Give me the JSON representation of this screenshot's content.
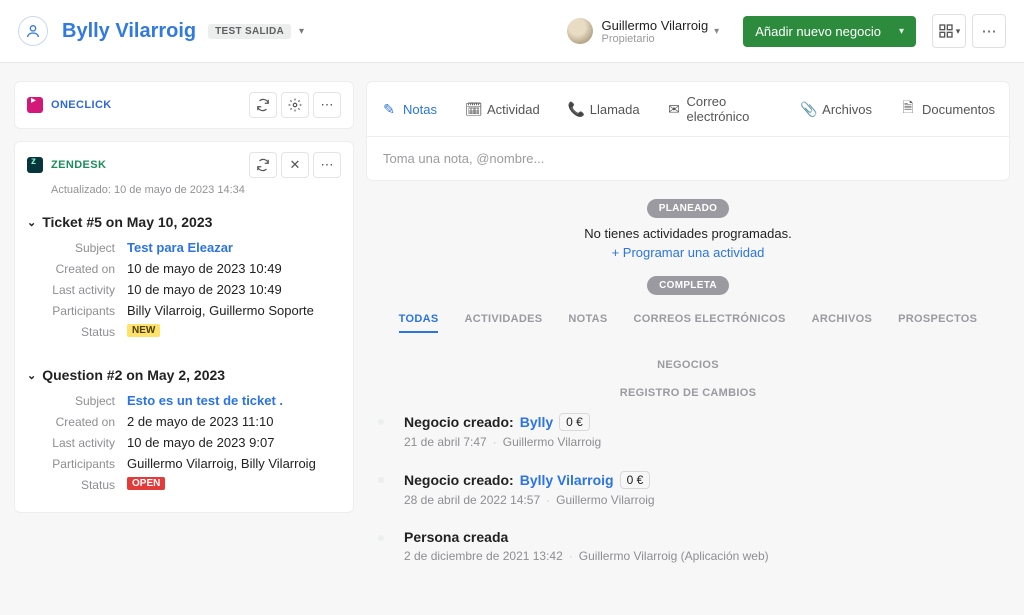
{
  "header": {
    "contact_name": "Bylly Vilarroig",
    "tag": "TEST SALIDA",
    "owner_name": "Guillermo Vilarroig",
    "owner_role": "Propietario",
    "add_deal_label": "Añadir nuevo negocio"
  },
  "integrations": {
    "oneclick": {
      "title": "ONECLICK"
    },
    "zendesk": {
      "title": "ZENDESK",
      "updated": "Actualizado: 10 de mayo de 2023 14:34"
    }
  },
  "tickets": [
    {
      "heading": "Ticket #5 on May 10, 2023",
      "rows": {
        "subject_label": "Subject",
        "subject_value": "Test para Eleazar",
        "created_label": "Created on",
        "created_value": "10 de mayo de 2023 10:49",
        "last_label": "Last activity",
        "last_value": "10 de mayo de 2023 10:49",
        "participants_label": "Participants",
        "participants_value": "Billy Vilarroig, Guillermo Soporte",
        "status_label": "Status",
        "status_value": "NEW",
        "status_badge": "new"
      }
    },
    {
      "heading": "Question #2 on May 2, 2023",
      "rows": {
        "subject_label": "Subject",
        "subject_value": "Esto es un test de ticket .",
        "created_label": "Created on",
        "created_value": "2 de mayo de 2023 11:10",
        "last_label": "Last activity",
        "last_value": "10 de mayo de 2023 9:07",
        "participants_label": "Participants",
        "participants_value": "Guillermo Vilarroig, Billy Vilarroig",
        "status_label": "Status",
        "status_value": "OPEN",
        "status_badge": "open"
      }
    }
  ],
  "compose_tabs": {
    "notes": "Notas",
    "activity": "Actividad",
    "call": "Llamada",
    "email": "Correo electrónico",
    "files": "Archivos",
    "documents": "Documentos"
  },
  "compose_placeholder": "Toma una nota, @nombre...",
  "sections": {
    "planned_pill": "PLANEADO",
    "empty_text": "No tienes actividades programadas.",
    "schedule_link": "+ Programar una actividad",
    "complete_pill": "COMPLETA"
  },
  "filters": {
    "todas": "TODAS",
    "actividades": "ACTIVIDADES",
    "notas": "NOTAS",
    "correos": "CORREOS ELECTRÓNICOS",
    "archivos": "ARCHIVOS",
    "prospectos": "PROSPECTOS",
    "negocios": "NEGOCIOS",
    "cambios": "REGISTRO DE CAMBIOS"
  },
  "timeline": [
    {
      "title_prefix": "Negocio creado:",
      "deal_name": "Bylly",
      "amount": "0 €",
      "meta_time": "21 de abril 7:47",
      "meta_user": "Guillermo Vilarroig"
    },
    {
      "title_prefix": "Negocio creado:",
      "deal_name": "Bylly Vilarroig",
      "amount": "0 €",
      "meta_time": "28 de abril de 2022 14:57",
      "meta_user": "Guillermo Vilarroig"
    },
    {
      "title_prefix": "Persona creada",
      "deal_name": "",
      "amount": "",
      "meta_time": "2 de diciembre de 2021 13:42",
      "meta_user": "Guillermo Vilarroig (Aplicación web)"
    }
  ]
}
